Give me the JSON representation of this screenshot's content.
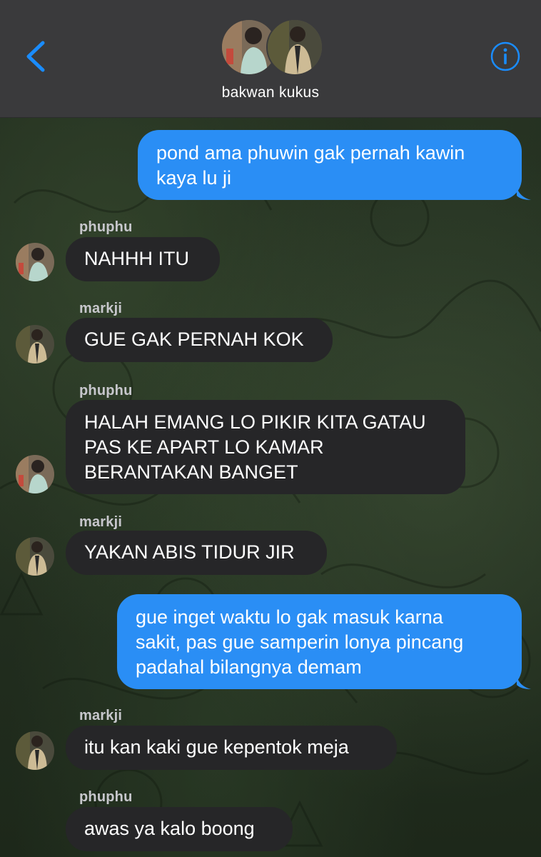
{
  "header": {
    "group_name": "bakwan kukus"
  },
  "icons": {
    "back": "chevron-left-icon",
    "info": "info-icon"
  },
  "colors": {
    "accent": "#2a8ef5",
    "outgoing_bubble": "#2a8ef5",
    "incoming_bubble": "#262628",
    "header_bg": "#3a3a3c"
  },
  "messages": [
    {
      "direction": "outgoing",
      "lines": [
        "pond ama phuwin gak pernah kawin",
        "kaya lu ji"
      ]
    },
    {
      "direction": "incoming",
      "sender": "phuphu",
      "lines": [
        "NAHHH ITU"
      ]
    },
    {
      "direction": "incoming",
      "sender": "markji",
      "lines": [
        "GUE GAK PERNAH KOK"
      ]
    },
    {
      "direction": "incoming",
      "sender": "phuphu",
      "lines": [
        "HALAH EMANG LO PIKIR KITA GATAU",
        "PAS KE APART LO KAMAR",
        "BERANTAKAN BANGET"
      ]
    },
    {
      "direction": "incoming",
      "sender": "markji",
      "lines": [
        "YAKAN ABIS TIDUR JIR"
      ]
    },
    {
      "direction": "outgoing",
      "lines": [
        "gue inget waktu lo gak masuk karna",
        "sakit, pas gue samperin lonya pincang",
        "padahal bilangnya demam"
      ]
    },
    {
      "direction": "incoming",
      "sender": "markji",
      "lines": [
        "itu kan kaki gue kepentok meja"
      ]
    },
    {
      "direction": "incoming",
      "sender": "phuphu",
      "lines": [
        "awas ya kalo boong"
      ]
    }
  ]
}
